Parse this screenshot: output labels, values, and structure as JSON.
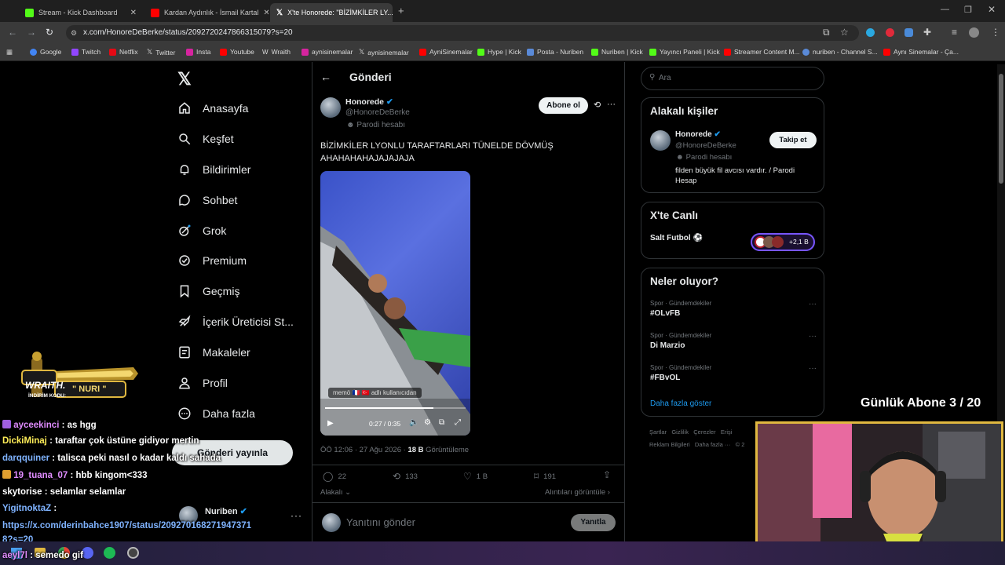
{
  "tabs": [
    {
      "label": "Stream - Kick Dashboard",
      "color": "#53fc18"
    },
    {
      "label": "Kardan Aydınlık - İsmail Kartal",
      "color": "#ff0000"
    },
    {
      "label": "X'te Honorede: \"BİZİMKİLER LY...",
      "color": "#ffffff"
    }
  ],
  "url": "x.com/HonoreDeBerke/status/2092720247866315079?s=20",
  "bookmarks": [
    "Google",
    "Twitch",
    "Netflix",
    "Twitter",
    "Insta",
    "Youtube",
    "Wraith",
    "aynisinemalar",
    "aynisinemalar",
    "AyniSinemalar",
    "Hype | Kick",
    "Posta - Nuriben",
    "Nuriben | Kick",
    "Yayıncı Paneli | Kick",
    "Streamer Content M...",
    "nuriben - Channel S...",
    "Aynı Sinemalar - Ça..."
  ],
  "nav": {
    "logo": "X",
    "items": [
      "Anasayfa",
      "Keşfet",
      "Bildirimler",
      "Sohbet",
      "Grok",
      "Premium",
      "Geçmiş",
      "İçerik Üreticisi St...",
      "Makaleler",
      "Profil",
      "Daha fazla"
    ],
    "post_button": "Gönderi yayınla",
    "account_name": "Nuriben"
  },
  "post": {
    "header": "Gönderi",
    "author": "Honorede",
    "handle": "@HonoreDeBerke",
    "parody": "Parodi hesabı",
    "follow": "Abone ol",
    "text": "BİZİMKİLER LYONLU TARAFTARLARI TÜNELDE DÖVMÜŞ AHAHAHAHAJAJAJAJA",
    "video_time": "0:27 / 0:35",
    "video_watermark": "memö 🇫🇷 🇹🇷 adlı kullanıcıdan",
    "timestamp": "ÖÖ 12:06 · 27 Ağu 2026 ·",
    "views_count": "18 B",
    "views_label": "Görüntüleme",
    "replies": "22",
    "reposts": "133",
    "likes": "1 B",
    "bookmarks": "191",
    "related": "Alakalı",
    "quotes": "Alıntıları görüntüle",
    "reply_placeholder": "Yanıtını gönder",
    "reply_button": "Yanıtla"
  },
  "right": {
    "search_placeholder": "Ara",
    "related_title": "Alakalı kişiler",
    "person_name": "Honorede",
    "person_handle": "@HonoreDeBerke",
    "person_parody": "Parodi hesabı",
    "person_bio": "filden büyük fil avcısı vardır. / Parodi Hesap",
    "follow_button": "Takip et",
    "live_title": "X'te Canlı",
    "live_name": "Salt Futbol ⚽",
    "live_count": "+2,1 B",
    "trends_title": "Neler oluyor?",
    "trends": [
      {
        "category": "Spor · Gündemdekiler",
        "name": "#OLvFB"
      },
      {
        "category": "Spor · Gündemdekiler",
        "name": "Di Marzio"
      },
      {
        "category": "Spor · Gündemdekiler",
        "name": "#FBvOL"
      }
    ],
    "show_more": "Daha fazla göster",
    "footer1": "Şartlar   Gizlilik   Çerezler   Erişi",
    "footer2": "Reklam Bilgileri   Daha fazla ···   © 2"
  },
  "overlay": {
    "sub_goal": "Günlük Abone 3 / 20",
    "sponsor_brand": "WRAITH.",
    "sponsor_code_label": "İNDİRİM KODU:",
    "sponsor_code": "\" NURI \"",
    "chat": [
      {
        "user": "ayceekinci",
        "msg": ": as hgg",
        "color": "#e08cff"
      },
      {
        "user": "DickiMinaj",
        "msg": ": taraftar çok üstüne gidiyor mertin",
        "color": "#ffee58"
      },
      {
        "user": "darqquiner",
        "msg": ": talisca peki nasıl o kadar kaldı sahada",
        "color": "#7fb3ff"
      },
      {
        "user": "19_tuana_07",
        "msg": ": hbb kingom<333",
        "color": "#e08cff"
      },
      {
        "user": "skytorise",
        "msg": ": selamlar selamlar",
        "color": "#ffffff"
      },
      {
        "user": "YigitnoktaZ",
        "msg": ":",
        "color": "#7fb3ff"
      },
      {
        "user": "",
        "msg": "https://x.com/derinbahce1907/status/2092701682719473718?s=20",
        "color": "#7fb3ff"
      },
      {
        "user": "aeyl7l",
        "msg": ": semedo gif",
        "color": "#e08cff"
      }
    ]
  }
}
